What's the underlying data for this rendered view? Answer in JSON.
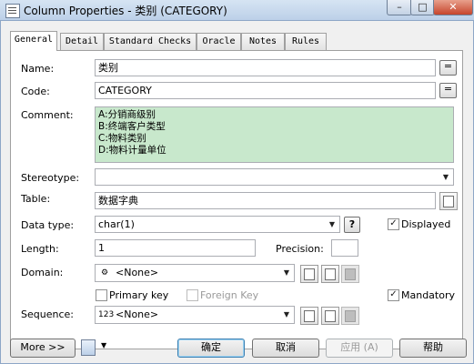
{
  "window": {
    "title": "Column Properties - 类别 (CATEGORY)",
    "buttons": {
      "minimize": "–",
      "maximize": "□",
      "close": "✕"
    }
  },
  "tabs": [
    {
      "label": "General",
      "active": true
    },
    {
      "label": "Detail"
    },
    {
      "label": "Standard Checks"
    },
    {
      "label": "Oracle"
    },
    {
      "label": "Notes"
    },
    {
      "label": "Rules"
    }
  ],
  "form": {
    "name_label": "Name:",
    "name_value": "类别",
    "code_label": "Code:",
    "code_value": "CATEGORY",
    "comment_label": "Comment:",
    "comment_lines": [
      "A:分销商级别",
      "B:终端客户类型",
      "C:物料类别",
      "D:物料计量单位"
    ],
    "stereotype_label": "Stereotype:",
    "stereotype_value": "",
    "table_label": "Table:",
    "table_value": "数据字典",
    "datatype_label": "Data type:",
    "datatype_value": "char(1)",
    "datatype_help": "?",
    "displayed_label": "Displayed",
    "displayed_checked": true,
    "length_label": "Length:",
    "length_value": "1",
    "precision_label": "Precision:",
    "precision_value": "",
    "domain_label": "Domain:",
    "domain_value": "<None>",
    "primary_key_label": "Primary key",
    "primary_key_checked": false,
    "foreign_key_label": "Foreign Key",
    "foreign_key_checked": false,
    "mandatory_label": "Mandatory",
    "mandatory_checked": true,
    "sequence_label": "Sequence:",
    "sequence_value": "<None>",
    "ellipsis": "="
  },
  "footer": {
    "more_label": "More >>",
    "ok_label": "确定",
    "cancel_label": "取消",
    "apply_label": "应用 (A)",
    "help_label": "帮助"
  },
  "colors": {
    "comment_bg": "#c8e8cc",
    "titlebar": "#c6d7ea"
  }
}
